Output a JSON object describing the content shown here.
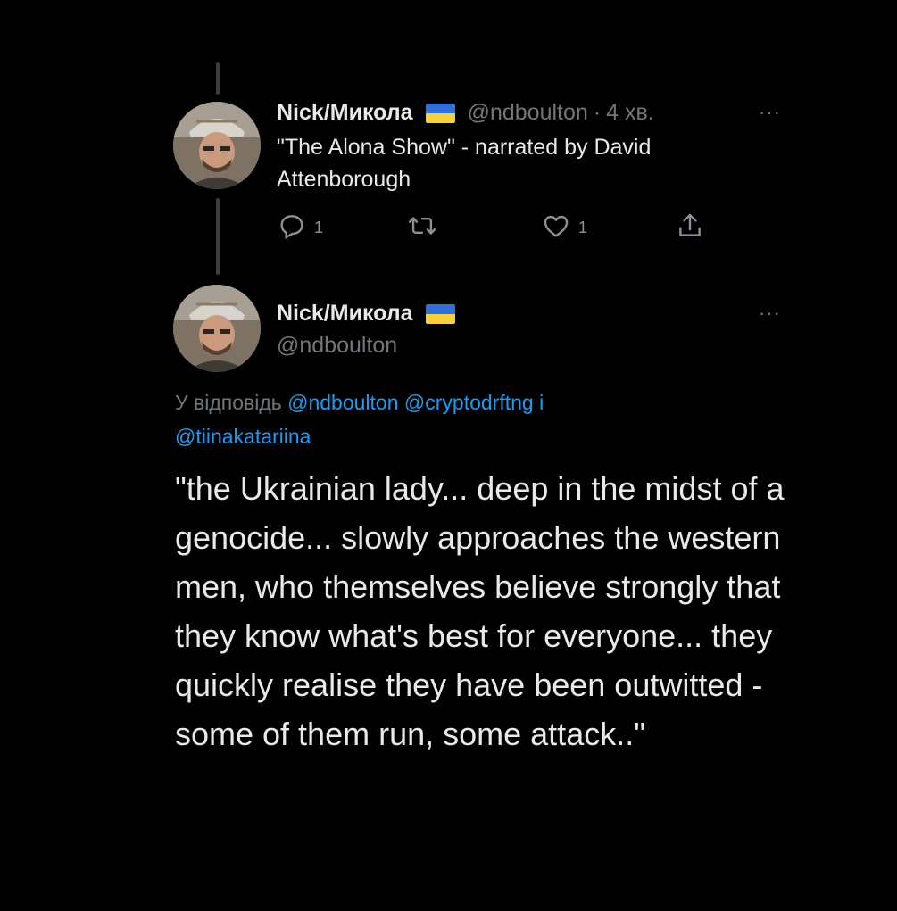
{
  "parent_tweet": {
    "display_name": "Nick/Микола",
    "handle": "@ndboulton",
    "separator": "·",
    "time": "4 хв.",
    "text": "\"The Alona Show\" - narrated by David Attenborough",
    "reply_count": "1",
    "like_count": "1",
    "more_label": "···"
  },
  "main_tweet": {
    "display_name": "Nick/Микола",
    "handle": "@ndboulton",
    "more_label": "···",
    "reply_prefix": "У відповідь",
    "reply_mentions": [
      "@ndboulton",
      "@cryptodrftng"
    ],
    "reply_conjunction": "і",
    "reply_mention_last": "@tiinakatariina",
    "text": "\"the Ukrainian lady... deep in the midst of a genocide... slowly approaches the western men, who themselves believe strongly that they know what's best for everyone... they quickly realise they have been outwitted - some of them run, some attack..\""
  },
  "colors": {
    "background": "#000000",
    "primary_text": "#e7e9ea",
    "secondary_text": "#71767b",
    "link": "#1d9bf0",
    "flag_blue": "#2f6fd6",
    "flag_yellow": "#f6d13a"
  },
  "icons": {
    "reply": "reply-icon",
    "retweet": "retweet-icon",
    "like": "like-icon",
    "share": "share-icon",
    "more": "more-icon",
    "flag": "ukraine-flag-icon"
  }
}
